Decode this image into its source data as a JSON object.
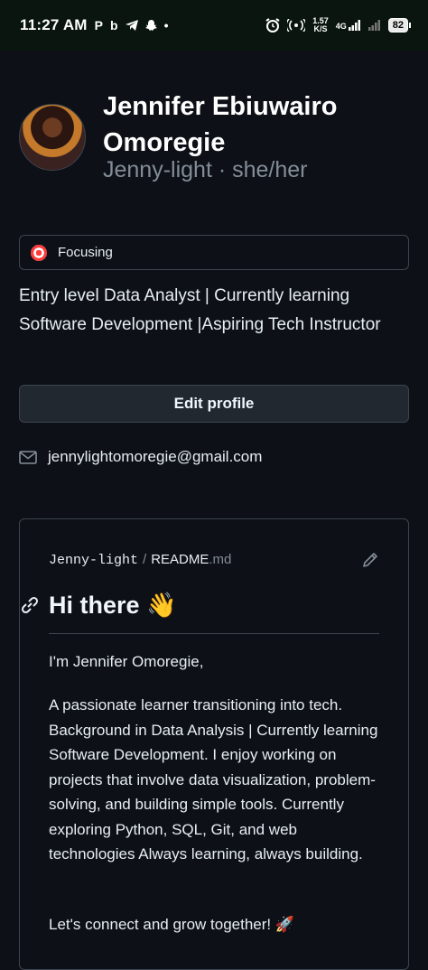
{
  "status_bar": {
    "time": "11:27 AM",
    "left_icons": [
      "P",
      "b",
      "telegram-icon",
      "snapchat-icon",
      "•"
    ],
    "speed_value": "1.57",
    "speed_unit": "K/S",
    "network": "4G",
    "battery": "82"
  },
  "profile": {
    "name": "Jennifer Ebiuwairo Omoregie",
    "handle": "Jenny-light · she/her",
    "status": "Focusing",
    "bio": "Entry level Data Analyst | Currently learning Software Development |Aspiring Tech Instructor",
    "edit_button": "Edit profile",
    "email": "jennylightomoregie@gmail.com"
  },
  "readme": {
    "owner": "Jenny-light",
    "separator": "/",
    "file_name": "README",
    "file_ext": ".md",
    "heading": "Hi there 👋",
    "paragraphs": [
      "I'm Jennifer Omoregie,",
      "A passionate learner transitioning into tech. Background in Data Analysis | Currently learning Software Development. I enjoy working on projects that involve data visualization, problem-solving, and building simple tools. Currently exploring Python, SQL, Git, and web technologies Always learning, always building.",
      "Let's connect and grow together! 🚀"
    ]
  },
  "colors": {
    "background": "#0d1117",
    "border": "#3d444d",
    "muted_text": "#848d97",
    "text": "#e6edf3"
  }
}
